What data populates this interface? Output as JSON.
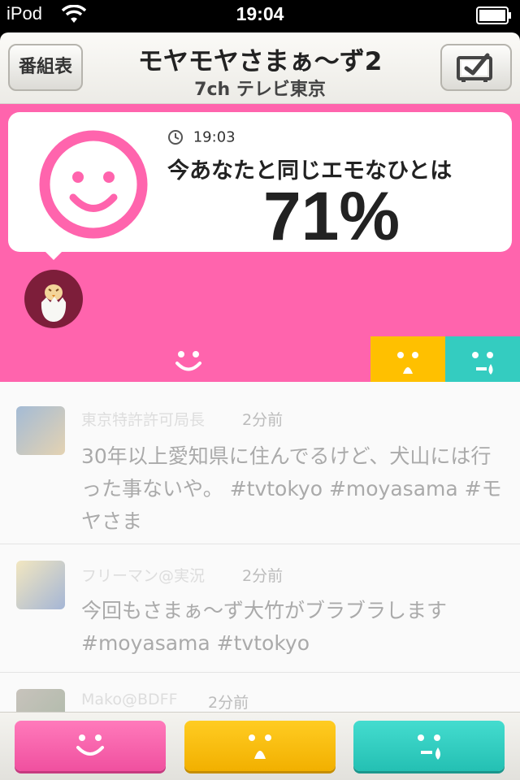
{
  "status_bar": {
    "carrier": "iPod",
    "time": "19:04"
  },
  "nav": {
    "left_button": "番組表",
    "title": "モヤモヤさまぁ〜ず2",
    "channel": "7ch テレビ東京",
    "right_icon": "tv-check-icon"
  },
  "mood_card": {
    "time": "19:03",
    "label": "今あなたと同じエモなひとは",
    "percent": "71%"
  },
  "mood_bar": {
    "happy_color": "#ff64ad",
    "surprised_color": "#ffc000",
    "sad_color": "#34ccc0"
  },
  "feed": {
    "tweets": [
      {
        "user": "東京特許許可局長",
        "ago": "2分前",
        "text": "30年以上愛知県に住んでるけど、犬山には行った事ないや。 #tvtokyo #moyasama #モヤさま"
      },
      {
        "user": "フリーマン@実況",
        "ago": "2分前",
        "text": "今回もさまぁ〜ず大竹がブラブラします #moyasama #tvtokyo"
      },
      {
        "user": "Mako@BDFF",
        "ago": "2分前",
        "text": ""
      }
    ]
  },
  "toolbar": {
    "buttons": [
      "smile-face-icon",
      "surprised-face-icon",
      "crying-face-icon"
    ]
  }
}
